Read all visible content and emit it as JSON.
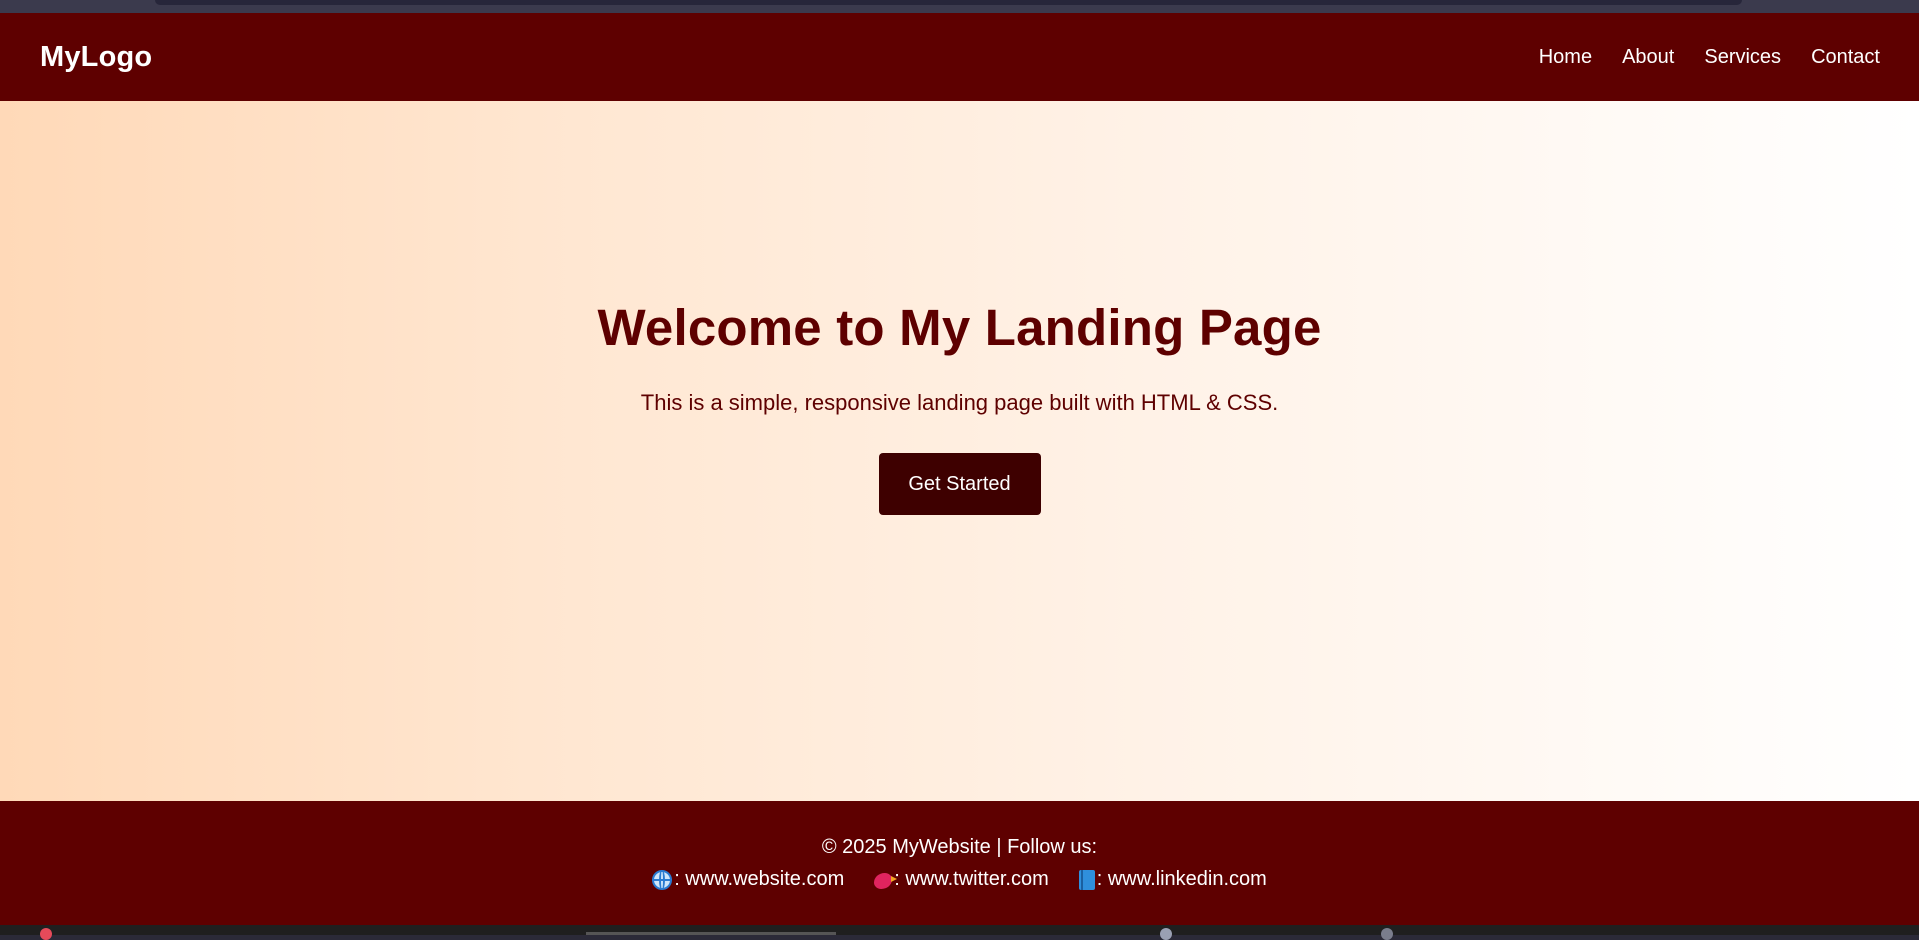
{
  "header": {
    "logo": "MyLogo",
    "nav": [
      {
        "label": "Home"
      },
      {
        "label": "About"
      },
      {
        "label": "Services"
      },
      {
        "label": "Contact"
      }
    ]
  },
  "hero": {
    "title": "Welcome to My Landing Page",
    "subtitle": "This is a simple, responsive landing page built with HTML & CSS.",
    "cta_label": "Get Started"
  },
  "footer": {
    "copyright": "© 2025 MyWebsite | Follow us:",
    "links": [
      {
        "icon": "globe-icon",
        "text": ": www.website.com"
      },
      {
        "icon": "bird-icon",
        "text": ": www.twitter.com"
      },
      {
        "icon": "book-icon",
        "text": ": www.linkedin.com"
      }
    ]
  },
  "colors": {
    "brand": "#5e0000",
    "button": "#3e0000",
    "hero_gradient_start": "#ffd9b8",
    "hero_gradient_end": "#ffffff"
  }
}
